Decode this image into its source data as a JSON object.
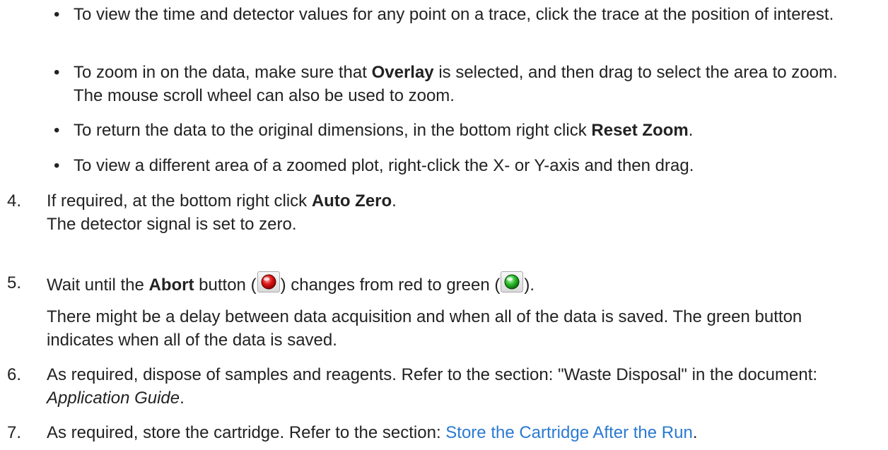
{
  "bullets": [
    {
      "text": "To view the time and detector values for any point on a trace, click the trace at the position of interest."
    },
    {
      "pre": "To zoom in on the data, make sure that ",
      "bold": "Overlay",
      "post": " is selected, and then drag to select the area to zoom. The mouse scroll wheel can also be used to zoom."
    },
    {
      "pre": "To return the data to the original dimensions, in the bottom right click ",
      "bold": "Reset Zoom",
      "post": "."
    },
    {
      "text": "To view a different area of a zoomed plot, right-click the X- or Y-axis and then drag."
    }
  ],
  "bullet_glyph": "•",
  "steps": {
    "s4": {
      "num": "4.",
      "pre": "If required, at the bottom right click ",
      "bold": "Auto Zero",
      "post": ".",
      "line2": "The detector signal is set to zero."
    },
    "s5": {
      "num": "5.",
      "pre": "Wait until the ",
      "bold": "Abort",
      "mid1": " button (",
      "mid2": ") changes from red to green (",
      "post": ").",
      "para": "There might be a delay between data acquisition and when all of the data is saved. The green button indicates when all of the data is saved."
    },
    "s6": {
      "num": "6.",
      "pre": "As required, dispose of samples and reagents. Refer to the section: \"Waste Disposal\" in the document: ",
      "italic": "Application Guide",
      "post": "."
    },
    "s7": {
      "num": "7.",
      "pre": "As required, store the cartridge. Refer to the section: ",
      "link": "Store the Cartridge After the Run",
      "post": "."
    }
  },
  "icons": {
    "abort_red": "red-abort-button-icon",
    "abort_green": "green-button-icon"
  },
  "colors": {
    "text": "#222222",
    "link": "#2a7ad1",
    "red": "#e01818",
    "green": "#2fbf2f"
  }
}
